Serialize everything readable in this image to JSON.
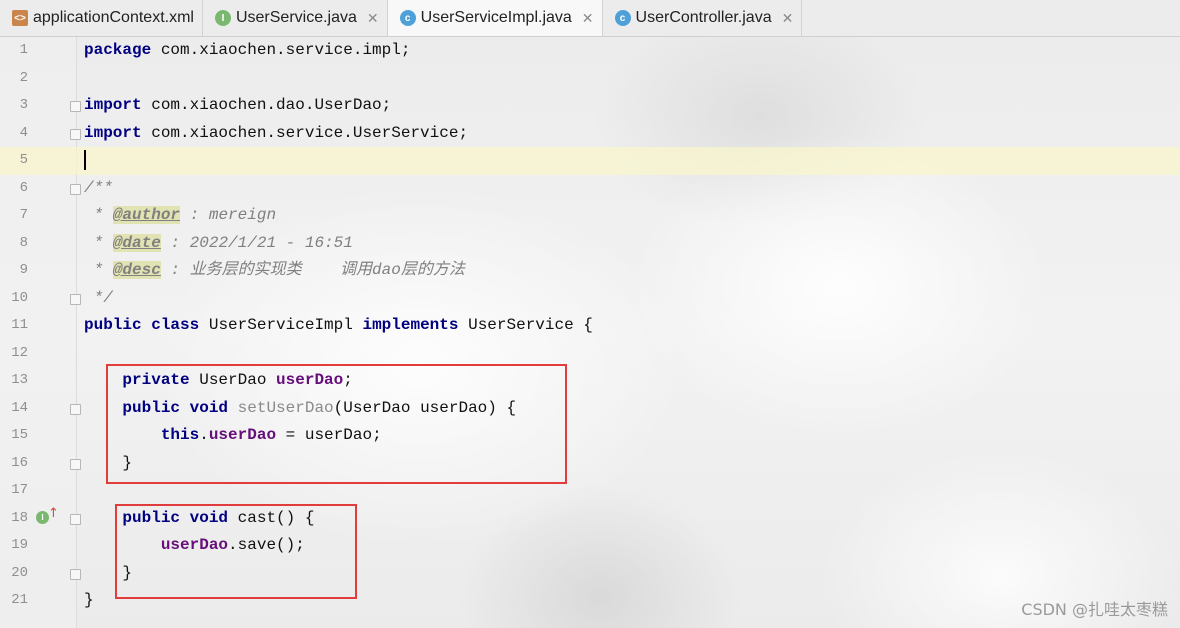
{
  "tabs": [
    {
      "label": "applicationContext.xml",
      "icon": "xml-file-icon",
      "closable": false,
      "active": false
    },
    {
      "label": "UserService.java",
      "icon": "interface-icon",
      "closable": true,
      "active": false
    },
    {
      "label": "UserServiceImpl.java",
      "icon": "class-icon",
      "closable": true,
      "active": true
    },
    {
      "label": "UserController.java",
      "icon": "class-icon",
      "closable": true,
      "active": false
    }
  ],
  "editor": {
    "current_line": 5,
    "lines": [
      {
        "n": "1",
        "code": [
          {
            "t": "kw",
            "v": "package"
          },
          {
            "t": "plain",
            "v": " com.xiaochen.service.impl;"
          }
        ]
      },
      {
        "n": "2",
        "code": []
      },
      {
        "n": "3",
        "code": [
          {
            "t": "kw",
            "v": "import"
          },
          {
            "t": "plain",
            "v": " com.xiaochen.dao.UserDao;"
          }
        ]
      },
      {
        "n": "4",
        "code": [
          {
            "t": "kw",
            "v": "import"
          },
          {
            "t": "plain",
            "v": " com.xiaochen.service.UserService;"
          }
        ]
      },
      {
        "n": "5",
        "code": []
      },
      {
        "n": "6",
        "code": [
          {
            "t": "cmt",
            "v": "/**"
          }
        ]
      },
      {
        "n": "7",
        "code": [
          {
            "t": "cmt",
            "v": " * "
          },
          {
            "t": "tag",
            "v": "@author"
          },
          {
            "t": "cmt",
            "v": " : mereign"
          }
        ]
      },
      {
        "n": "8",
        "code": [
          {
            "t": "cmt",
            "v": " * "
          },
          {
            "t": "tag",
            "v": "@date"
          },
          {
            "t": "cmt",
            "v": " : 2022/1/21 - 16:51"
          }
        ]
      },
      {
        "n": "9",
        "code": [
          {
            "t": "cmt",
            "v": " * "
          },
          {
            "t": "tag",
            "v": "@desc"
          },
          {
            "t": "cmt",
            "v": " : 业务层的实现类    调用dao层的方法"
          }
        ]
      },
      {
        "n": "10",
        "code": [
          {
            "t": "cmt",
            "v": " */"
          }
        ]
      },
      {
        "n": "11",
        "code": [
          {
            "t": "kw",
            "v": "public"
          },
          {
            "t": "plain",
            "v": " "
          },
          {
            "t": "kw",
            "v": "class"
          },
          {
            "t": "plain",
            "v": " UserServiceImpl "
          },
          {
            "t": "kw",
            "v": "implements"
          },
          {
            "t": "plain",
            "v": " UserService {"
          }
        ]
      },
      {
        "n": "12",
        "code": []
      },
      {
        "n": "13",
        "code": [
          {
            "t": "plain",
            "v": "    "
          },
          {
            "t": "kw",
            "v": "private"
          },
          {
            "t": "plain",
            "v": " UserDao "
          },
          {
            "t": "field",
            "v": "userDao"
          },
          {
            "t": "plain",
            "v": ";"
          }
        ]
      },
      {
        "n": "14",
        "code": [
          {
            "t": "plain",
            "v": "    "
          },
          {
            "t": "kw",
            "v": "public"
          },
          {
            "t": "plain",
            "v": " "
          },
          {
            "t": "kw",
            "v": "void"
          },
          {
            "t": "plain",
            "v": " "
          },
          {
            "t": "unused",
            "v": "setUserDao"
          },
          {
            "t": "plain",
            "v": "(UserDao userDao) {"
          }
        ]
      },
      {
        "n": "15",
        "code": [
          {
            "t": "plain",
            "v": "        "
          },
          {
            "t": "kw",
            "v": "this"
          },
          {
            "t": "plain",
            "v": "."
          },
          {
            "t": "field",
            "v": "userDao"
          },
          {
            "t": "plain",
            "v": " = userDao;"
          }
        ]
      },
      {
        "n": "16",
        "code": [
          {
            "t": "plain",
            "v": "    }"
          }
        ]
      },
      {
        "n": "17",
        "code": []
      },
      {
        "n": "18",
        "code": [
          {
            "t": "plain",
            "v": "    "
          },
          {
            "t": "kw",
            "v": "public"
          },
          {
            "t": "plain",
            "v": " "
          },
          {
            "t": "kw",
            "v": "void"
          },
          {
            "t": "plain",
            "v": " cast() {"
          }
        ]
      },
      {
        "n": "19",
        "code": [
          {
            "t": "plain",
            "v": "        "
          },
          {
            "t": "field",
            "v": "userDao"
          },
          {
            "t": "plain",
            "v": ".save();"
          }
        ]
      },
      {
        "n": "20",
        "code": [
          {
            "t": "plain",
            "v": "    }"
          }
        ]
      },
      {
        "n": "21",
        "code": [
          {
            "t": "plain",
            "v": "}"
          }
        ]
      }
    ]
  },
  "gutter_icon_label": "I",
  "watermark": "CSDN @扎哇太枣糕",
  "colors": {
    "keyword": "#000080",
    "field": "#660e7a",
    "comment": "#808080",
    "highlight_box": "#e23d3d"
  }
}
